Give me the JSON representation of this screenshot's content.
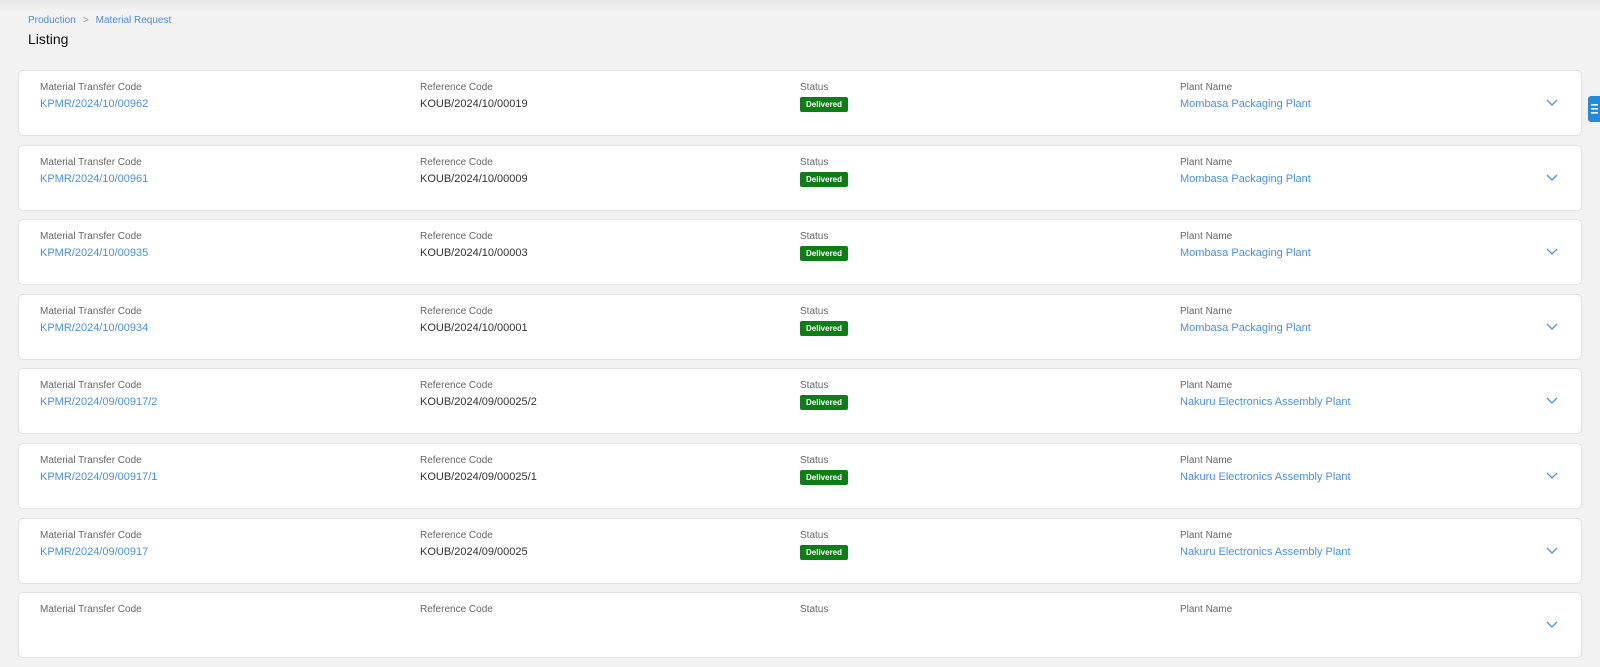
{
  "breadcrumb": {
    "items": [
      "Production",
      "Material Request"
    ]
  },
  "page_title": "Listing",
  "columns": {
    "transfer_code": "Material Transfer Code",
    "reference_code": "Reference Code",
    "status": "Status",
    "plant_name": "Plant Name"
  },
  "records": [
    {
      "transfer_code": "KPMR/2024/10/00962",
      "reference_code": "KOUB/2024/10/00019",
      "status": "Delivered",
      "plant_name": "Mombasa Packaging Plant"
    },
    {
      "transfer_code": "KPMR/2024/10/00961",
      "reference_code": "KOUB/2024/10/00009",
      "status": "Delivered",
      "plant_name": "Mombasa Packaging Plant"
    },
    {
      "transfer_code": "KPMR/2024/10/00935",
      "reference_code": "KOUB/2024/10/00003",
      "status": "Delivered",
      "plant_name": "Mombasa Packaging Plant"
    },
    {
      "transfer_code": "KPMR/2024/10/00934",
      "reference_code": "KOUB/2024/10/00001",
      "status": "Delivered",
      "plant_name": "Mombasa Packaging Plant"
    },
    {
      "transfer_code": "KPMR/2024/09/00917/2",
      "reference_code": "KOUB/2024/09/00025/2",
      "status": "Delivered",
      "plant_name": "Nakuru Electronics Assembly Plant"
    },
    {
      "transfer_code": "KPMR/2024/09/00917/1",
      "reference_code": "KOUB/2024/09/00025/1",
      "status": "Delivered",
      "plant_name": "Nakuru Electronics Assembly Plant"
    },
    {
      "transfer_code": "KPMR/2024/09/00917",
      "reference_code": "KOUB/2024/09/00025",
      "status": "Delivered",
      "plant_name": "Nakuru Electronics Assembly Plant"
    },
    {
      "transfer_code": "",
      "reference_code": "",
      "status": "",
      "plant_name": ""
    }
  ],
  "colors": {
    "link": "#4a90d9",
    "status_delivered": "#0e7d17",
    "side_tab": "#1f8ddd"
  },
  "icons": {
    "expand": "chevron-down-icon",
    "side_menu": "menu-icon"
  }
}
